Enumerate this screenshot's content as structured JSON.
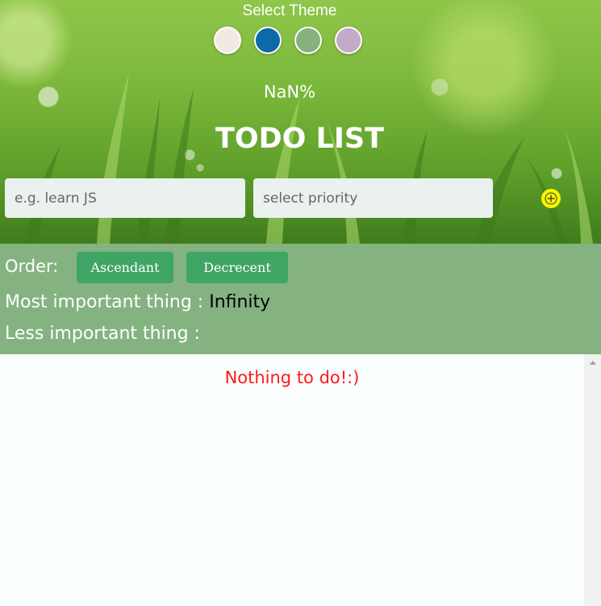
{
  "theme": {
    "title": "Select Theme",
    "swatches": [
      {
        "name": "cream",
        "color": "#f3e9e3"
      },
      {
        "name": "blue",
        "color": "#0b6aa8"
      },
      {
        "name": "sage",
        "color": "#88b07d"
      },
      {
        "name": "lavender",
        "color": "#c4a9c9"
      }
    ]
  },
  "progress": {
    "text": "NaN%"
  },
  "app": {
    "title": "TODO LIST"
  },
  "form": {
    "task_placeholder": "e.g. learn JS",
    "priority_placeholder": "select priority",
    "add_icon": "plus-circle-icon",
    "add_color": "#f7f700"
  },
  "order": {
    "label": "Order:",
    "ascending_label": "Ascendant",
    "descending_label": "Decrecent"
  },
  "stats": {
    "most_label": "Most important thing : ",
    "most_value": "Infinity",
    "less_label": "Less important thing : ",
    "less_value": ""
  },
  "list": {
    "empty_message": "Nothing to do!:)"
  }
}
